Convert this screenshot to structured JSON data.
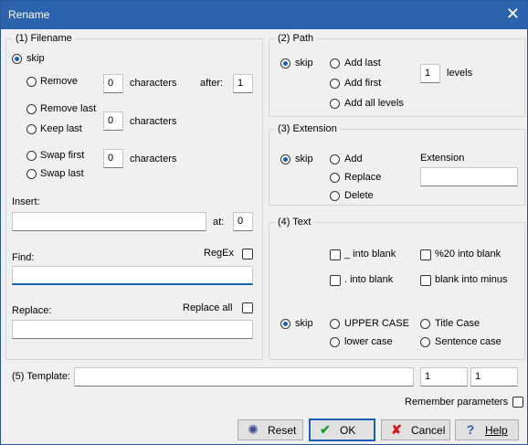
{
  "window": {
    "title": "Rename",
    "close_glyph": "✕"
  },
  "filename": {
    "legend": "(1) Filename",
    "skip": "skip",
    "remove": "Remove",
    "remove_count": "0",
    "characters_1": "characters",
    "after": "after:",
    "after_value": "1",
    "remove_last": "Remove last",
    "keep_last": "Keep last",
    "keep_count": "0",
    "characters_2": "characters",
    "swap_first": "Swap first",
    "swap_last": "Swap last",
    "swap_count": "0",
    "characters_3": "characters",
    "insert_label": "Insert:",
    "insert_value": "",
    "at_label": "at:",
    "at_value": "0",
    "find_label": "Find:",
    "regex_label": "RegEx",
    "find_value": "",
    "replace_label": "Replace:",
    "replace_all_label": "Replace all",
    "replace_value": ""
  },
  "path": {
    "legend": "(2) Path",
    "skip": "skip",
    "add_last": "Add last",
    "add_first": "Add first",
    "add_all": "Add all levels",
    "levels_value": "1",
    "levels_label": "levels"
  },
  "extension": {
    "legend": "(3) Extension",
    "skip": "skip",
    "add": "Add",
    "replace": "Replace",
    "delete": "Delete",
    "ext_label": "Extension",
    "ext_value": ""
  },
  "text": {
    "legend": "(4) Text",
    "underscore_blank": "_ into blank",
    "pct20_blank": "%20 into blank",
    "dot_blank": ". into blank",
    "blank_minus": "blank into minus",
    "skip": "skip",
    "upper": "UPPER CASE",
    "title": "Title Case",
    "lower": "lower case",
    "sentence": "Sentence case"
  },
  "template": {
    "label": "(5) Template:",
    "value": "",
    "num1": "1",
    "num2": "1"
  },
  "remember": {
    "label": "Remember parameters"
  },
  "buttons": {
    "reset": "Reset",
    "ok": "OK",
    "cancel": "Cancel",
    "help": "Help"
  },
  "colors": {
    "titlebar": "#2b63ad",
    "accent": "#1a5fb4",
    "ok_check": "#1e9e2a",
    "cancel_x": "#d01c1c"
  }
}
